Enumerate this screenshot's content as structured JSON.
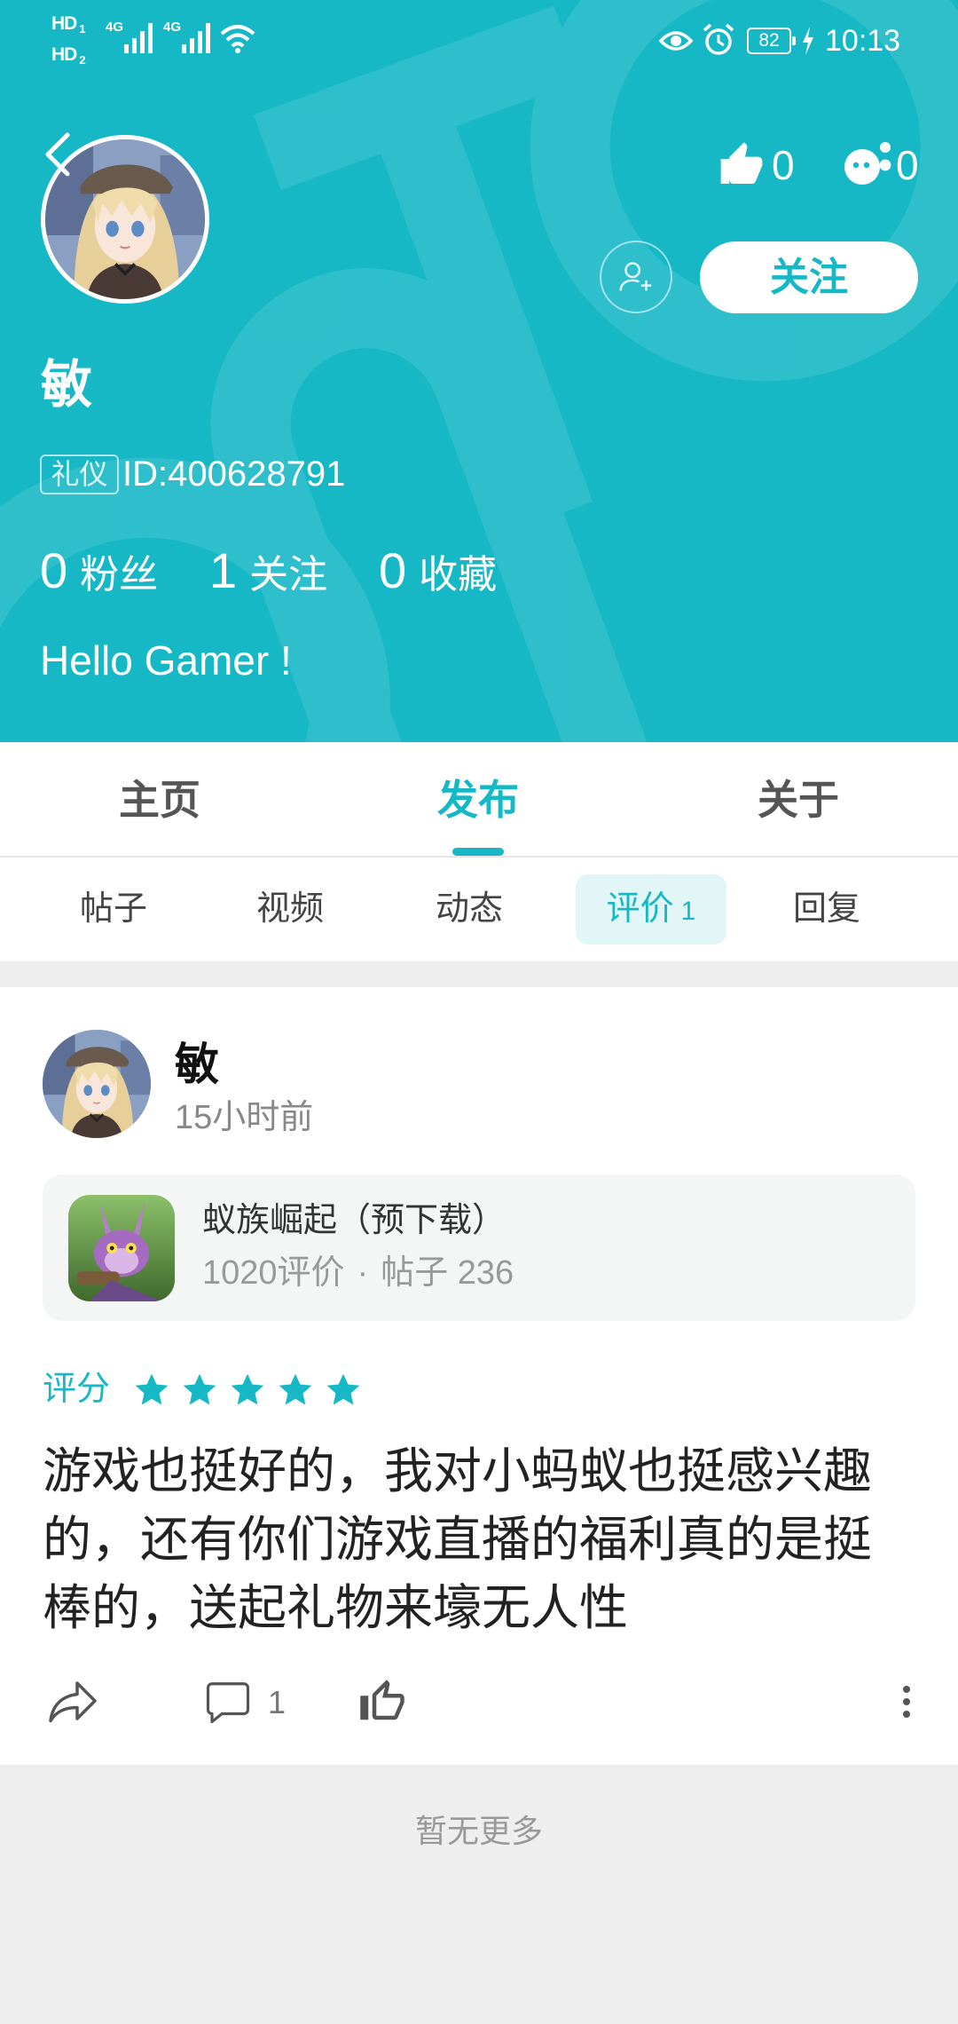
{
  "status_bar": {
    "hd1": "HD",
    "hd1_sub": "1",
    "hd2": "HD",
    "hd2_sub": "2",
    "net1": "4G",
    "net2": "4G",
    "battery": "82",
    "time": "10:13"
  },
  "profile": {
    "name": "敏",
    "badge": "礼仪",
    "id_text": "ID:400628791",
    "likes_count": "0",
    "visitors_count": "0",
    "follow_label": "关注",
    "stats": [
      {
        "value": "0",
        "label": "粉丝"
      },
      {
        "value": "1",
        "label": "关注"
      },
      {
        "value": "0",
        "label": "收藏"
      }
    ],
    "bio": "Hello Gamer !"
  },
  "tabs": [
    {
      "label": "主页",
      "active": false
    },
    {
      "label": "发布",
      "active": true
    },
    {
      "label": "关于",
      "active": false
    }
  ],
  "sub_tabs": [
    {
      "label": "帖子",
      "active": false
    },
    {
      "label": "视频",
      "active": false
    },
    {
      "label": "动态",
      "active": false
    },
    {
      "label": "评价",
      "count": "1",
      "active": true
    },
    {
      "label": "回复",
      "active": false
    }
  ],
  "post": {
    "author": "敏",
    "time": "15小时前",
    "game": {
      "title": "蚁族崛起（预下载）",
      "reviews": "1020评价",
      "separator": "·",
      "posts": "帖子 236"
    },
    "rating_label": "评分",
    "rating": 5,
    "rating_max": 5,
    "text": "游戏也挺好的，我对小蚂蚁也挺感兴趣的，还有你们游戏直播的福利真的是挺棒的，送起礼物来壕无人性",
    "comment_count": "1"
  },
  "footer": {
    "no_more": "暂无更多"
  },
  "colors": {
    "accent": "#17b8c6",
    "active_subtab_bg": "#e2f5f7",
    "page_bg": "#eeeeee",
    "star_empty": "#dddddd"
  },
  "icons": {
    "back": "back-arrow-icon",
    "likes": "thumbs-up-icon",
    "visitors": "visitor-face-icon",
    "add_friend": "add-friend-icon",
    "share": "share-icon",
    "comment": "comment-icon",
    "like": "like-outline-icon",
    "more": "more-vertical-icon"
  }
}
